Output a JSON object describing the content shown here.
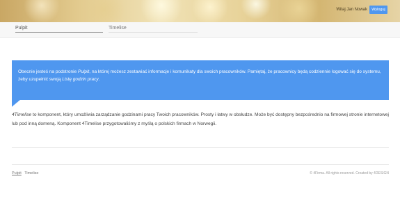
{
  "header": {
    "welcome": "Witaj Jan Nowak",
    "logout_label": "Wyloguj"
  },
  "nav": {
    "tabs": [
      {
        "label": "Pulpit"
      },
      {
        "label": "Timelise"
      }
    ]
  },
  "info": {
    "text_1": "Obecnie jesteś na podstronie ",
    "page_name": "Pulpit",
    "text_2": ", na której możesz zestawiać informacje i komunikaty dla swoich pracowników. Pamiętaj, że pracownicy będą codziennie logować się do systemu, żeby uzupełnić swoją ",
    "link_text": "Listę godzin pracy",
    "text_3": "."
  },
  "content": {
    "product_name": "4Timelise",
    "text": " to komponent, który umożliwia zarządzanie godzinami pracy Twoich pracowników. Prosty i łatwy w obsłudze. Może być dostępny bezpośrednio na firmowej stronie internetowej lub pod inną domeną. Komponent 4Timelise przygotowaliśmy z myślą o polskich firmach w Norwegii."
  },
  "footer": {
    "links": [
      "Pulpit",
      "Timelise"
    ],
    "copyright": "© 4Firma. All rights reserved. Created by 4DESIGN"
  },
  "colors": {
    "accent": "#4f97ef",
    "header_gold": "#e3cb8f"
  }
}
